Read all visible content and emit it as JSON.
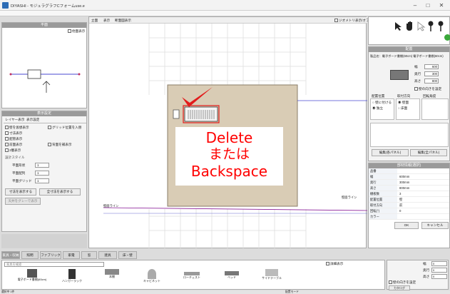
{
  "window": {
    "title": "DIYASHI - モジュラグラフCフォームuse.e",
    "min": "–",
    "max": "□",
    "close": "✕"
  },
  "left_top": {
    "header": "平面",
    "check_label": "他面表示"
  },
  "left_mid": {
    "header": "表示設定",
    "tab1": "レイヤー表示",
    "tab2": "表示設定",
    "checks": [
      "壁を仮想表示",
      "グリッド位置を入替",
      "寸法表示",
      "配管表示",
      "前面表示",
      "背面を補表示",
      "2層表示",
      "天井をグレーで表示"
    ],
    "section": "設計スタイル",
    "rows": [
      {
        "label": "平面形状",
        "value": "1"
      },
      {
        "label": "平面配列",
        "value": "1"
      },
      {
        "label": "平面グリッド",
        "value": "1"
      }
    ],
    "btn1": "寸法を表示する",
    "btn2": "全寸法を表示する"
  },
  "canvas": {
    "tabs": [
      "立面",
      "表示",
      "断面図表示"
    ],
    "corner_label": "ジオメトリ表示/オフ",
    "line_label_left": "壁面ライン",
    "line_label_right": "壁面ライン"
  },
  "overlay": {
    "line1": "Delete",
    "line2": "または",
    "line3": "Backspace"
  },
  "right_panel": {
    "header": "配置",
    "info": "製品名：電子ボード書棚(60cm) 電子ボード書棚(60cm)",
    "dims": [
      {
        "label": "幅",
        "value": "600"
      },
      {
        "label": "奥行",
        "value": "300"
      },
      {
        "label": "高さ",
        "value": "800"
      }
    ],
    "options_label": "壁の向きを設定",
    "group_labels": [
      "配置位置",
      "取付方向",
      "回転角度"
    ],
    "radio_opts": [
      "壁に付ける",
      "独立",
      "壁面",
      "床面"
    ],
    "btn_a": "編集(各パネル)",
    "btn_b": "編集(全パネル)",
    "table_header": "部材情報(選択)",
    "props": [
      {
        "k": "品番",
        "v": ""
      },
      {
        "k": "幅",
        "v": "600mm"
      },
      {
        "k": "奥行",
        "v": "300mm"
      },
      {
        "k": "高さ",
        "v": "800mm"
      },
      {
        "k": "棚板数",
        "v": "3"
      },
      {
        "k": "配置位置",
        "v": "壁"
      },
      {
        "k": "取付方向",
        "v": "前"
      },
      {
        "k": "回転(°)",
        "v": "0"
      },
      {
        "k": "カラー",
        "v": ""
      }
    ],
    "ok": "OK",
    "cancel": "キャンセル"
  },
  "bottom": {
    "tabs": [
      "家具・収納",
      "照明",
      "ファブリック",
      "家電",
      "窓",
      "建具",
      "床・壁"
    ],
    "search_placeholder": "家具を検索",
    "check_label": "詳細表示",
    "items": [
      "電子ボード書棚(60cm)",
      "ハンガーラック",
      "本棚",
      "キャビネット",
      "ローチェスト",
      "ベッド",
      "サイドテーブル"
    ],
    "side_fields": [
      {
        "label": "幅",
        "value": "0"
      },
      {
        "label": "奥行",
        "value": "0"
      },
      {
        "label": "高さ",
        "value": "0"
      }
    ],
    "side_check": "壁の向きを設定",
    "side_btn": "カタログ"
  },
  "status": {
    "left": "選択中 1件",
    "right": "配置モード"
  },
  "colors": {
    "accent": "#ff0000",
    "floor": "#d9ccb5",
    "check": "#e21b1b"
  }
}
